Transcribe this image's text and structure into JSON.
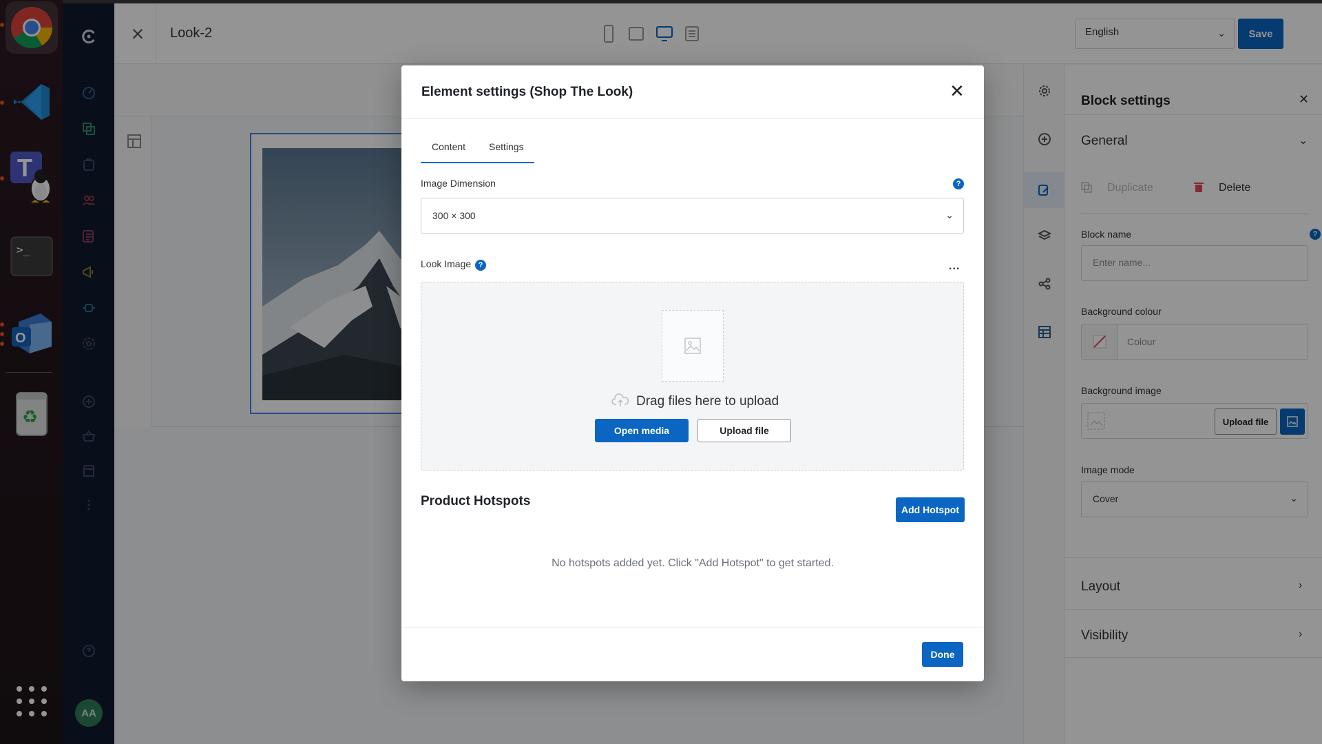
{
  "colors": {
    "accent": "#0a66c2",
    "sidebar": "#0f1b2d",
    "dock": "#2b1a22"
  },
  "dock": {
    "apps": [
      {
        "name": "chrome-icon"
      },
      {
        "name": "vscode-icon"
      },
      {
        "name": "teams-linux-icon"
      },
      {
        "name": "terminal-icon"
      },
      {
        "name": "outlook-icon"
      },
      {
        "name": "recycle-bin-icon"
      },
      {
        "name": "app-grid-icon"
      }
    ]
  },
  "header": {
    "title": "Look-2",
    "language": "English",
    "save_label": "Save"
  },
  "sidebar": {
    "avatar_initials": "AA"
  },
  "block_settings": {
    "title": "Block settings",
    "general_label": "General",
    "duplicate_label": "Duplicate",
    "delete_label": "Delete",
    "block_name_label": "Block name",
    "block_name_placeholder": "Enter name...",
    "bg_colour_label": "Background colour",
    "colour_placeholder": "Colour",
    "bg_image_label": "Background image",
    "upload_file_label": "Upload file",
    "image_mode_label": "Image mode",
    "image_mode_value": "Cover",
    "layout_label": "Layout",
    "visibility_label": "Visibility"
  },
  "modal": {
    "title": "Element settings (Shop The Look)",
    "tabs": [
      {
        "label": "Content"
      },
      {
        "label": "Settings"
      }
    ],
    "image_dimension_label": "Image Dimension",
    "image_dimension_value": "300 × 300",
    "look_image_label": "Look Image",
    "more_label": "...",
    "drop_text": "Drag files here to upload",
    "open_media_label": "Open media",
    "upload_file_label": "Upload file",
    "hotspots_title": "Product Hotspots",
    "add_hotspot_label": "Add Hotspot",
    "empty_message": "No hotspots added yet. Click \"Add Hotspot\" to get started.",
    "done_label": "Done"
  }
}
